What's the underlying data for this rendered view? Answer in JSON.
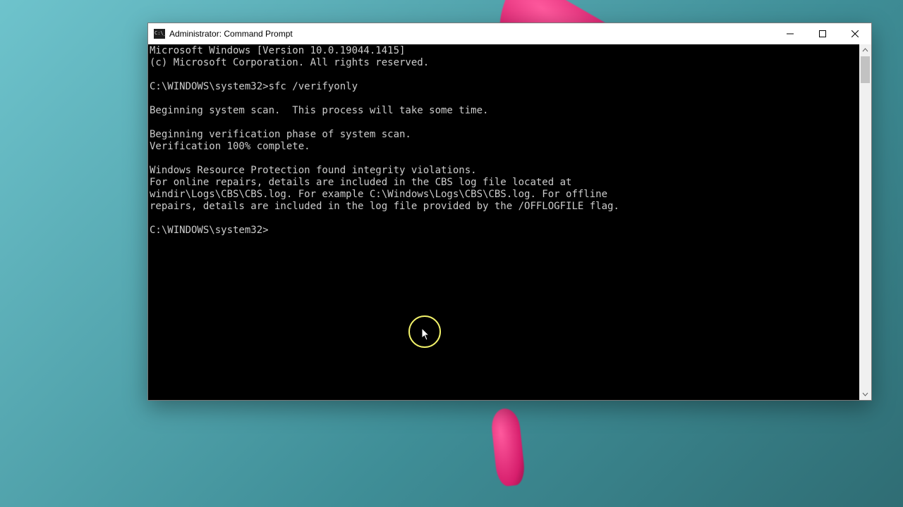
{
  "window": {
    "title": "Administrator: Command Prompt"
  },
  "console": {
    "lines": [
      "Microsoft Windows [Version 10.0.19044.1415]",
      "(c) Microsoft Corporation. All rights reserved.",
      "",
      "C:\\WINDOWS\\system32>sfc /verifyonly",
      "",
      "Beginning system scan.  This process will take some time.",
      "",
      "Beginning verification phase of system scan.",
      "Verification 100% complete.",
      "",
      "Windows Resource Protection found integrity violations.",
      "For online repairs, details are included in the CBS log file located at",
      "windir\\Logs\\CBS\\CBS.log. For example C:\\Windows\\Logs\\CBS\\CBS.log. For offline",
      "repairs, details are included in the log file provided by the /OFFLOGFILE flag.",
      "",
      "C:\\WINDOWS\\system32>"
    ]
  }
}
